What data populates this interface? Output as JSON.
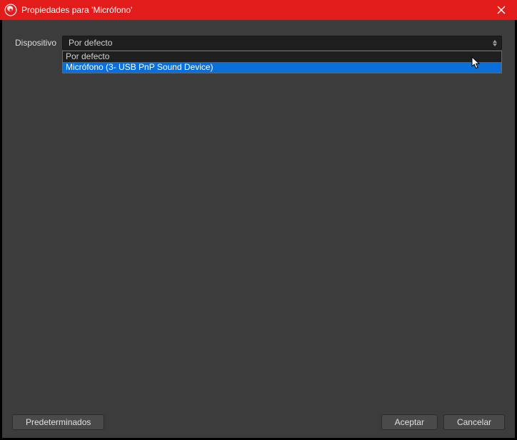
{
  "window": {
    "title": "Propiedades para 'Micrófono'"
  },
  "form": {
    "device_label": "Dispositivo",
    "selected": "Por defecto",
    "options": {
      "0": "Por defecto",
      "1": "Micrófono (3- USB PnP Sound Device)"
    }
  },
  "buttons": {
    "defaults": "Predeterminados",
    "ok": "Aceptar",
    "cancel": "Cancelar"
  }
}
